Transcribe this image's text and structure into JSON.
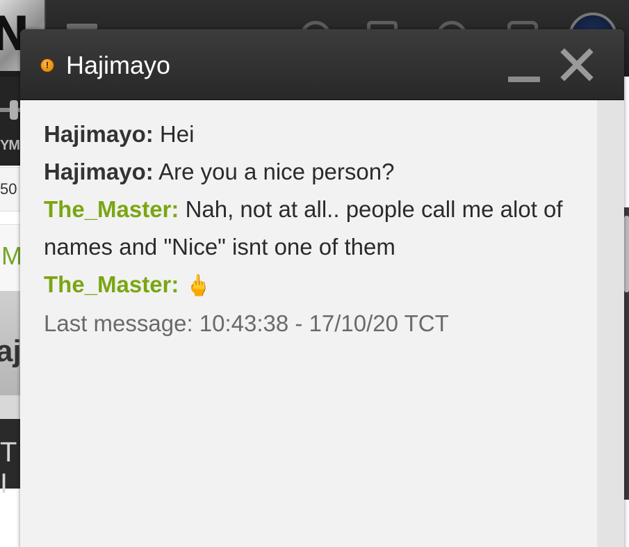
{
  "background": {
    "logo_letter": "N",
    "strip_label": "YM",
    "row_number": "50",
    "row_letter": "M",
    "row_partial_name": "aj",
    "dark_row_text": "T I"
  },
  "chat": {
    "title": "Hajimayo",
    "status_icon": "warning-dot-icon",
    "minimize_icon": "minimize-icon",
    "close_icon": "close-icon",
    "messages": [
      {
        "sender": "Hajimayo:",
        "text": "Hei",
        "role": "self"
      },
      {
        "sender": "Hajimayo:",
        "text": "Are you a nice person?",
        "role": "self"
      },
      {
        "sender": "The_Master:",
        "text": "Nah, not at all.. people call me alot of names and \"Nice\" isnt one of them",
        "role": "other"
      },
      {
        "sender": "The_Master:",
        "text": "🖕",
        "role": "other"
      }
    ],
    "last_message": "Last message: 10:43:38 - 17/10/20 TCT"
  },
  "colors": {
    "header_bg": "#2e2e2e",
    "body_bg": "#f2f2f2",
    "self_sender": "#333333",
    "other_sender": "#7aa613",
    "status_dot": "#e08a00",
    "meta_text": "#6a6a6a"
  }
}
